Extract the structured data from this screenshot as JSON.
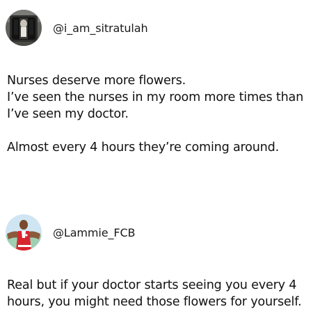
{
  "posts": [
    {
      "handle": "@i_am_sitratulah",
      "avatar_icon": "dark-portrait-avatar-icon",
      "paragraphs": [
        [
          "Nurses deserve more flowers.",
          "I’ve seen the nurses in my room more times than",
          "I’ve seen my doctor."
        ],
        [
          "Almost every 4 hours they’re coming around."
        ]
      ]
    },
    {
      "handle": "@Lammie_FCB",
      "avatar_icon": "football-player-avatar-icon",
      "paragraphs": [
        [
          "Real but if your doctor starts seeing you every 4",
          "hours, you might need those flowers for yourself."
        ]
      ]
    }
  ],
  "colors": {
    "text": "#111111",
    "background": "#ffffff",
    "jersey_red": "#d8262f"
  }
}
